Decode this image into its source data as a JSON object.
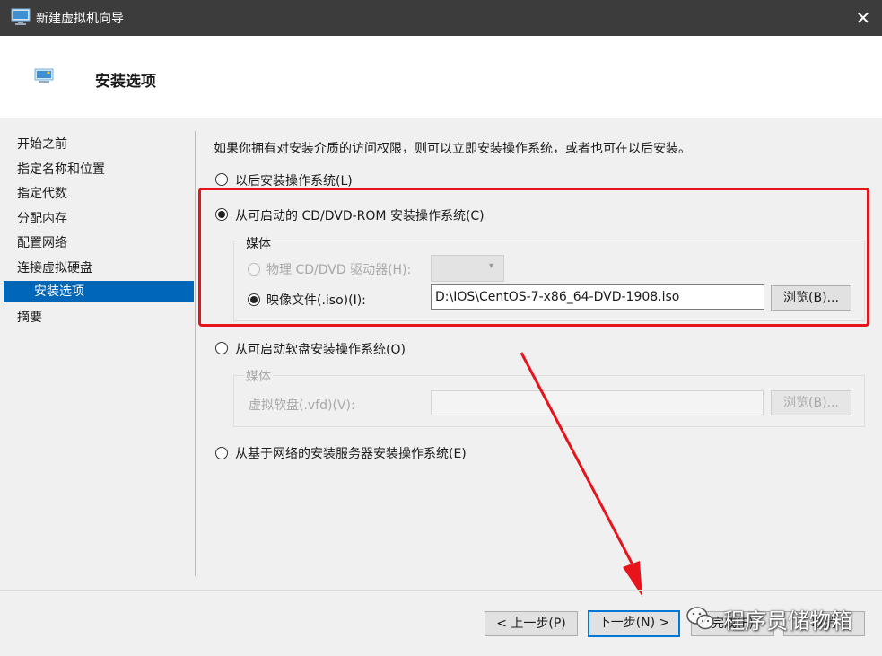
{
  "window": {
    "title": "新建虚拟机向导",
    "close_glyph": "✕"
  },
  "header": {
    "title": "安装选项"
  },
  "nav": {
    "items": [
      {
        "label": "开始之前"
      },
      {
        "label": "指定名称和位置"
      },
      {
        "label": "指定代数"
      },
      {
        "label": "分配内存"
      },
      {
        "label": "配置网络"
      },
      {
        "label": "连接虚拟硬盘"
      },
      {
        "label": "安装选项",
        "selected": true
      },
      {
        "label": "摘要"
      }
    ]
  },
  "content": {
    "intro": "如果你拥有对安装介质的访问权限，则可以立即安装操作系统，或者也可在以后安装。",
    "option_later": "以后安装操作系统(L)",
    "option_cd": "从可启动的 CD/DVD-ROM 安装操作系统(C)",
    "cd_group": {
      "legend": "媒体",
      "physical_label": "物理 CD/DVD 驱动器(H):",
      "image_label": "映像文件(.iso)(I):",
      "image_value": "D:\\IOS\\CentOS-7-x86_64-DVD-1908.iso",
      "browse_label": "浏览(B)..."
    },
    "option_floppy": "从可启动软盘安装操作系统(O)",
    "floppy_group": {
      "legend": "媒体",
      "vfd_label": "虚拟软盘(.vfd)(V):",
      "vfd_value": "",
      "browse_label": "浏览(B)..."
    },
    "option_network": "从基于网络的安装服务器安装操作系统(E)",
    "selected_option": "cd"
  },
  "footer": {
    "prev_label": "< 上一步(P)",
    "next_label": "下一步(N) >",
    "finish_label": "完成(F)",
    "cancel_label": "取消"
  },
  "watermark": {
    "text": "程序员储物箱"
  },
  "colors": {
    "accent": "#0066b8",
    "highlight": "#e8141c",
    "titlebar": "#3c3c3c"
  }
}
